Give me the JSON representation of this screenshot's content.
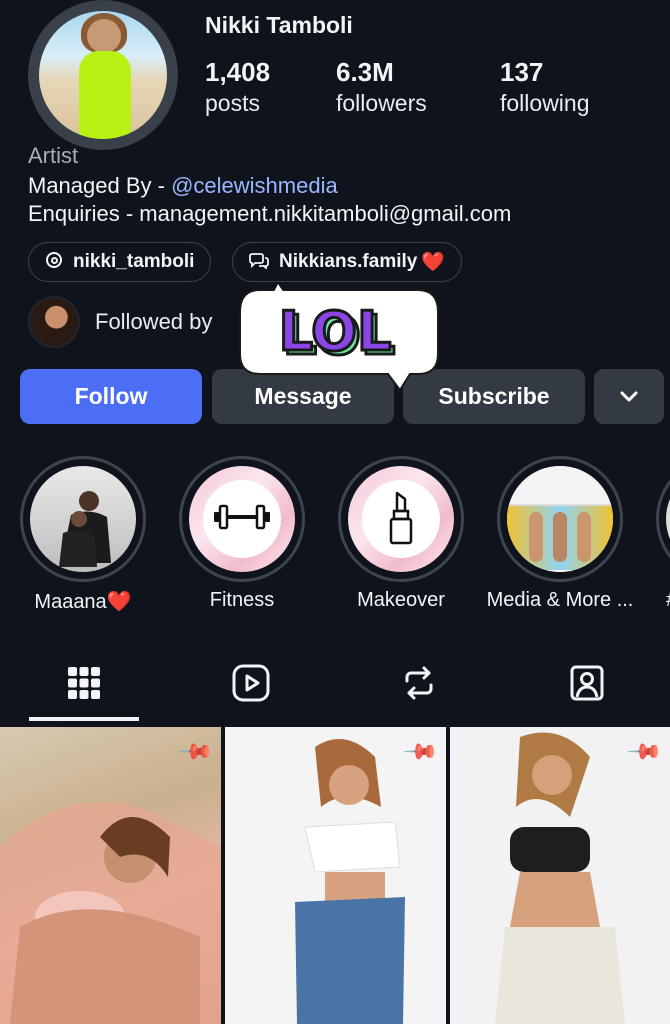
{
  "profile": {
    "name": "Nikki Tamboli",
    "stats": [
      {
        "value": "1,408",
        "label": "posts"
      },
      {
        "value": "6.3M",
        "label": "followers"
      },
      {
        "value": "137",
        "label": "following"
      }
    ],
    "category": "Artist",
    "bio_managed_prefix": "Managed By - ",
    "bio_managed_link": "@celewishmedia",
    "bio_enquiries": "Enquiries - management.nikkitamboli@gmail.com",
    "chips": [
      {
        "label": "nikki_tamboli",
        "icon": "threads-icon"
      },
      {
        "label": "Nikkians.family",
        "icon": "chat-bubbles-icon",
        "emoji": "❤️"
      }
    ],
    "followed_by": "Followed by"
  },
  "sticker": {
    "text": "LOL"
  },
  "actions": {
    "follow": "Follow",
    "message": "Message",
    "subscribe": "Subscribe",
    "more_icon": "chevron-down-icon"
  },
  "highlights": [
    {
      "label": "Maaana❤️",
      "kind": "photo"
    },
    {
      "label": "Fitness",
      "kind": "icon",
      "icon": "dumbbell-icon"
    },
    {
      "label": "Makeover",
      "kind": "icon",
      "icon": "lipstick-icon"
    },
    {
      "label": "Media & More ...",
      "kind": "photo"
    },
    {
      "label": "#",
      "kind": "partial"
    }
  ],
  "tabs": [
    {
      "icon": "grid-icon",
      "active": true
    },
    {
      "icon": "reels-icon",
      "active": false
    },
    {
      "icon": "reposts-icon",
      "active": false
    },
    {
      "icon": "tagged-icon",
      "active": false
    }
  ],
  "colors": {
    "background": "#0f141c",
    "accent": "#4c6ef5",
    "link": "#9ab6ff",
    "sticker_purple": "#8b46e8",
    "sticker_green": "#6ee69d"
  },
  "posts": [
    {
      "pinned": true,
      "icon": "pin-icon"
    },
    {
      "pinned": true,
      "icon": "pin-icon"
    },
    {
      "pinned": true,
      "icon": "pin-icon"
    }
  ]
}
